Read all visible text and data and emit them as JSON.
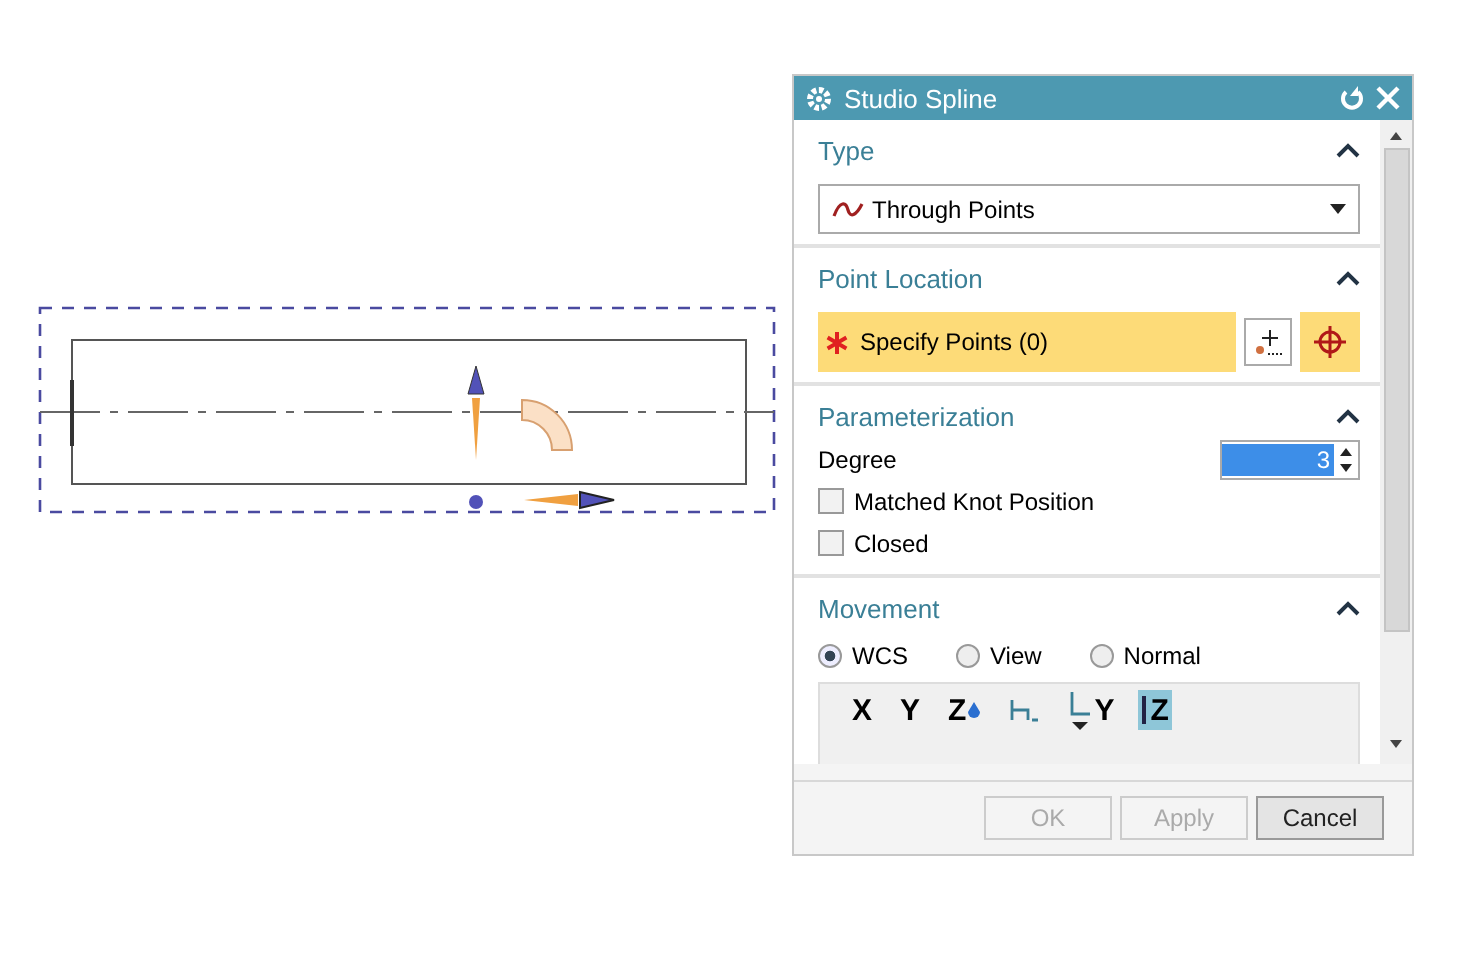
{
  "dialog": {
    "title": "Studio Spline"
  },
  "type_section": {
    "title": "Type",
    "dropdown": "Through Points"
  },
  "point_location": {
    "title": "Point Location",
    "selector": "Specify Points (0)"
  },
  "parameterization": {
    "title": "Parameterization",
    "degree_label": "Degree",
    "degree_value": "3",
    "options": [
      {
        "label": "Matched Knot Position",
        "checked": false
      },
      {
        "label": "Closed",
        "checked": false
      }
    ]
  },
  "movement": {
    "title": "Movement",
    "radios": [
      {
        "label": "WCS",
        "selected": true
      },
      {
        "label": "View",
        "selected": false
      },
      {
        "label": "Normal",
        "selected": false
      }
    ],
    "tools": [
      {
        "kind": "axis",
        "label": "X",
        "selected": false
      },
      {
        "kind": "axis",
        "label": "Y",
        "selected": false
      },
      {
        "kind": "axis-drop",
        "label": "Z",
        "selected": false
      },
      {
        "kind": "plane",
        "selected": false
      },
      {
        "kind": "corner",
        "label": "Y",
        "selected": false
      },
      {
        "kind": "bar",
        "label": "Z",
        "selected": true
      }
    ]
  },
  "buttons": [
    {
      "label": "OK",
      "disabled": true
    },
    {
      "label": "Apply",
      "disabled": true
    },
    {
      "label": "Cancel",
      "disabled": false
    }
  ]
}
